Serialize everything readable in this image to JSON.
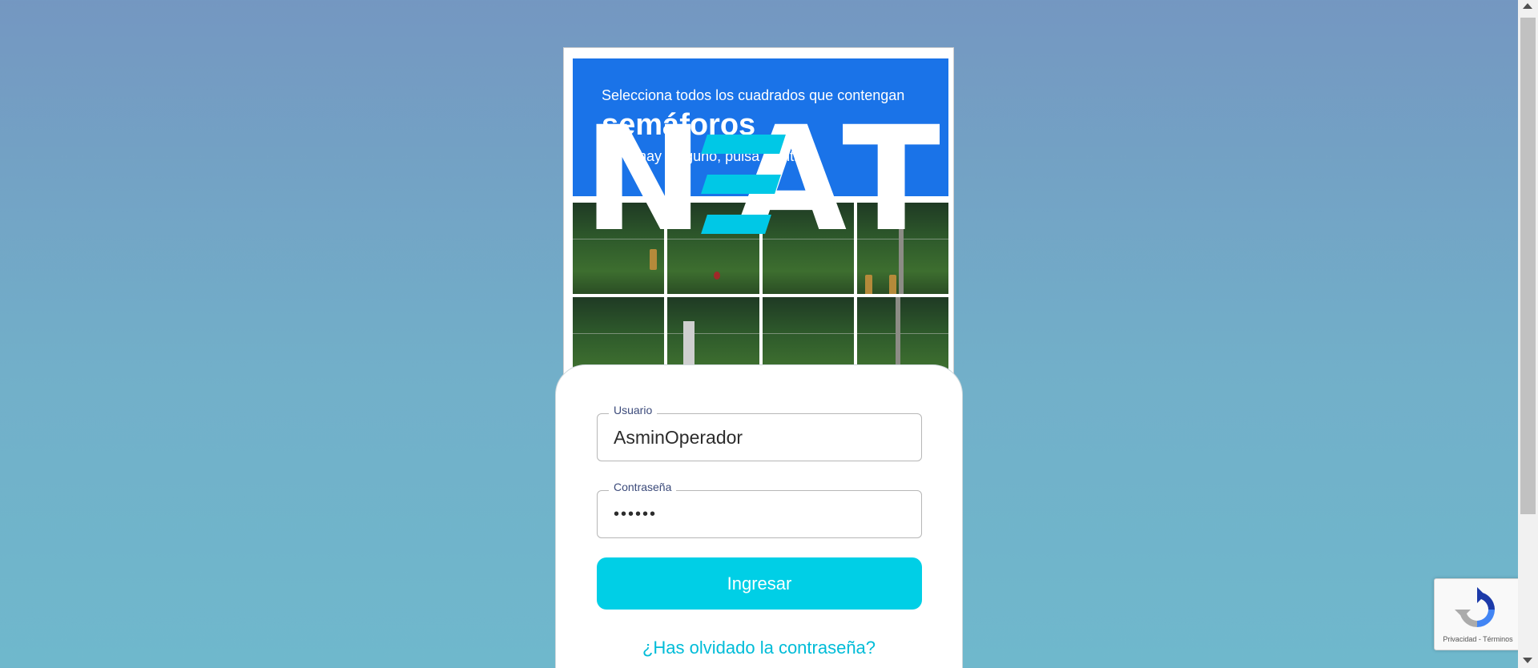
{
  "captcha": {
    "instruction": "Selecciona todos los cuadrados que contengan",
    "target": "semáforos",
    "hint": "Si no hay ninguno, pulsa Omitir"
  },
  "logo": {
    "text_n": "N",
    "text_a": "A",
    "text_t": "T",
    "accent_color": "#00c8e6"
  },
  "login": {
    "username_label": "Usuario",
    "username_value": "AsminOperador",
    "password_label": "Contraseña",
    "password_value": "••••••",
    "submit_label": "Ingresar",
    "forgot_label": "¿Has olvidado la contraseña?"
  },
  "recaptcha": {
    "terms": "Privacidad - Términos"
  },
  "colors": {
    "button": "#00cfe6",
    "captcha_header": "#1a73e8",
    "link": "#00bcd8"
  }
}
